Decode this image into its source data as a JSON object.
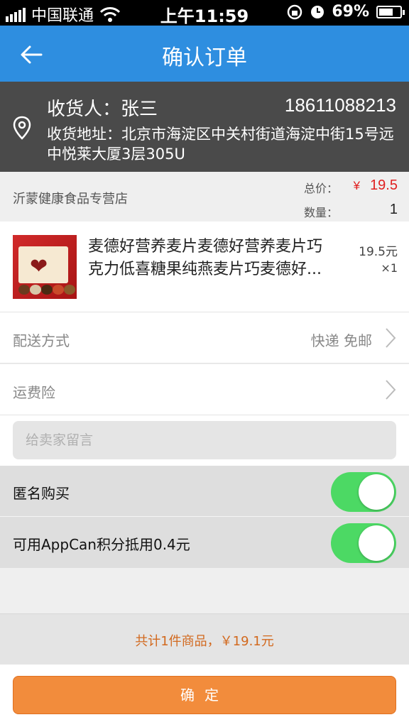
{
  "status_bar": {
    "carrier": "中国联通",
    "time": "上午11:59",
    "battery": "69%",
    "battery_level": 0.69
  },
  "nav": {
    "title": "确认订单",
    "back_icon": "back-arrow-icon"
  },
  "address": {
    "receiver_label": "收货人：",
    "receiver_name": "张三",
    "phone": "18611088213",
    "address_label": "收货地址：",
    "address_text": "北京市海淀区中关村街道海淀中街15号远中悦莱大厦3层305U"
  },
  "shop": {
    "name": "沂蒙健康食品专营店",
    "total_label": "总价：",
    "currency": "¥",
    "total_value": "19.5",
    "qty_label": "数量：",
    "qty_value": "1"
  },
  "item": {
    "title_line1": "麦德好营养麦片麦德好营养麦片巧",
    "title_line2": "克力低喜糖果纯燕麦片巧麦德好...",
    "price": "19.5元",
    "qty": "×1"
  },
  "delivery": {
    "label": "配送方式",
    "value": "快递 免邮"
  },
  "insurance": {
    "label": "运费险"
  },
  "message": {
    "placeholder": "给卖家留言"
  },
  "anonymous": {
    "label": "匿名购买",
    "on": true
  },
  "points": {
    "label": "可用AppCan积分抵用0.4元",
    "on": true
  },
  "summary": {
    "text": "共计1件商品，￥19.1元"
  },
  "footer": {
    "confirm_label": "确定"
  },
  "colors": {
    "nav_bg": "#2e8ee0",
    "price_red": "#e02020",
    "toggle_green": "#4cd964",
    "confirm_orange": "#f28c3c",
    "summary_orange": "#d2691e"
  }
}
